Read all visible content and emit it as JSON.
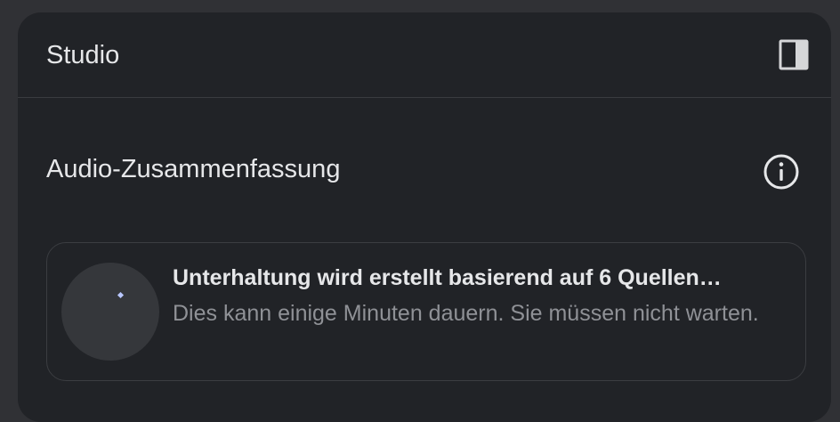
{
  "panel": {
    "title": "Studio",
    "collapse_icon": "side-panel-icon"
  },
  "audio_overview": {
    "title": "Audio-Zusammenfassung",
    "info_icon": "info-icon",
    "generation": {
      "title": "Unterhaltung wird erstellt basierend auf 6 Quellen…",
      "description": "Dies kann einige Minuten dauern. Sie müssen nicht warten."
    }
  },
  "colors": {
    "panel_background": "#212327",
    "page_background": "#303135",
    "text_primary": "#e6e7e9",
    "text_secondary": "#8f9196",
    "accent": "#b9c7ff"
  }
}
